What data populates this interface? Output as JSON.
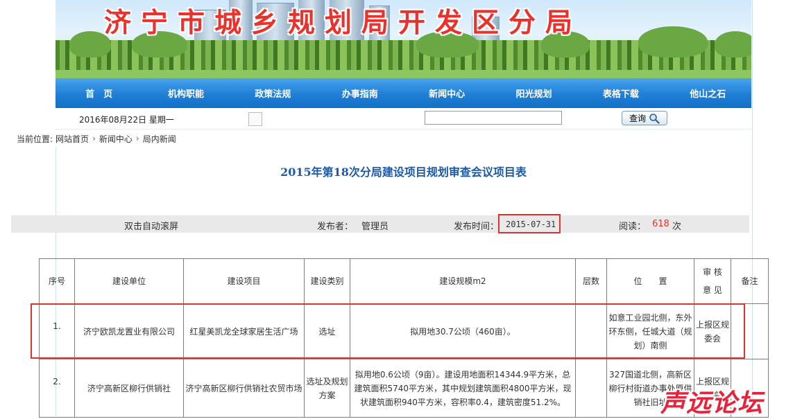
{
  "header": {
    "site_title": "济宁市城乡规划局开发区分局"
  },
  "nav": [
    "首　页",
    "机构职能",
    "政策法规",
    "办事指南",
    "新闻中心",
    "阳光规划",
    "表格下载",
    "他山之石"
  ],
  "infobar": {
    "date": "2016年08月22日 星期一",
    "search_value": "",
    "search_button": "查询"
  },
  "breadcrumb": {
    "label": "当前位置:",
    "items": [
      "网站首页",
      "新闻中心",
      "局内新闻"
    ]
  },
  "article": {
    "title": "2015年第18次分局建设项目规划审查会议项目表",
    "auto_scroll": "双击自动滚屏",
    "publisher_label": "发布者：",
    "publisher": "管理员",
    "time_label": "发布时间：",
    "time": "2015-07-31",
    "views_label": "阅读：",
    "views": "618",
    "views_unit": "次"
  },
  "table": {
    "headers": [
      "序号",
      "建设单位",
      "建设项目",
      "建设类别",
      "建设规模m2",
      "层数",
      "位　　置",
      "审 核\n意 见",
      "备注"
    ],
    "rows": [
      [
        "1.",
        "济宁欧凯龙置业有限公司",
        "红星美凯龙全球家居生活广场",
        "选址",
        "拟用地30.7公顷（460亩）。",
        "",
        "如意工业园北侧，东外环东侧，任城大道（规划）南侧",
        "上报区规委会",
        ""
      ],
      [
        "2.",
        "济宁高新区柳行供销社",
        "济宁高新区柳行供销社农贸市场",
        "选址及规划方案",
        "拟用地0.6公顷（9亩）。建设用地面积14344.9平方米，总建筑面积5740平方米，其中规划建筑面积4800平方米，现状建筑面积940平方米，容积率0.4，建筑密度51.2%。",
        "",
        "327国道北侧，高新区柳行村街道办事处原供销社旧址",
        "上报区规委会",
        ""
      ]
    ]
  },
  "watermark": "声远论坛",
  "colors": {
    "nav_blue": "#1f7fd6",
    "title_blue": "#1a5aa8",
    "highlight_red": "#e03030"
  },
  "icons": {
    "search_button": "magnifier-icon"
  }
}
